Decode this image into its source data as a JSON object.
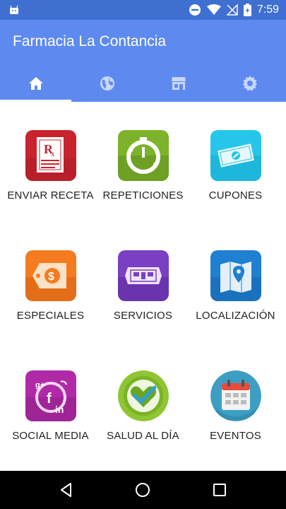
{
  "status_bar": {
    "time": "7:59"
  },
  "app_bar": {
    "title": "Farmacia La Contancia"
  },
  "tabs": [
    {
      "icon": "home-icon",
      "active": true
    },
    {
      "icon": "globe-icon",
      "active": false
    },
    {
      "icon": "store-icon",
      "active": false
    },
    {
      "icon": "gear-icon",
      "active": false
    }
  ],
  "grid": [
    {
      "label": "ENVIAR RECETA",
      "icon": "prescription-icon",
      "color": "#c9232e"
    },
    {
      "label": "REPETICIONES",
      "icon": "refill-timer-icon",
      "color": "#7cb32a"
    },
    {
      "label": "CUPONES",
      "icon": "coupon-icon",
      "color": "#25c6e9"
    },
    {
      "label": "ESPECIALES",
      "icon": "price-tag-icon",
      "color": "#f47b20"
    },
    {
      "label": "SERVICIOS",
      "icon": "services-icon",
      "color": "#7a3fc2"
    },
    {
      "label": "LOCALIZACIÓN",
      "icon": "map-pin-icon",
      "color": "#1f7fd0"
    },
    {
      "label": "SOCIAL MEDIA",
      "icon": "social-media-icon",
      "color": "#b02aa8"
    },
    {
      "label": "SALUD AL DÍA",
      "icon": "heart-check-icon",
      "color": "#8fc532"
    },
    {
      "label": "EVENTOS",
      "icon": "calendar-icon",
      "color": "#3e9ec2"
    }
  ],
  "colors": {
    "status_bar": "#3f6fd1",
    "app_bar": "#5e8af0",
    "nav_bar": "#000000"
  }
}
